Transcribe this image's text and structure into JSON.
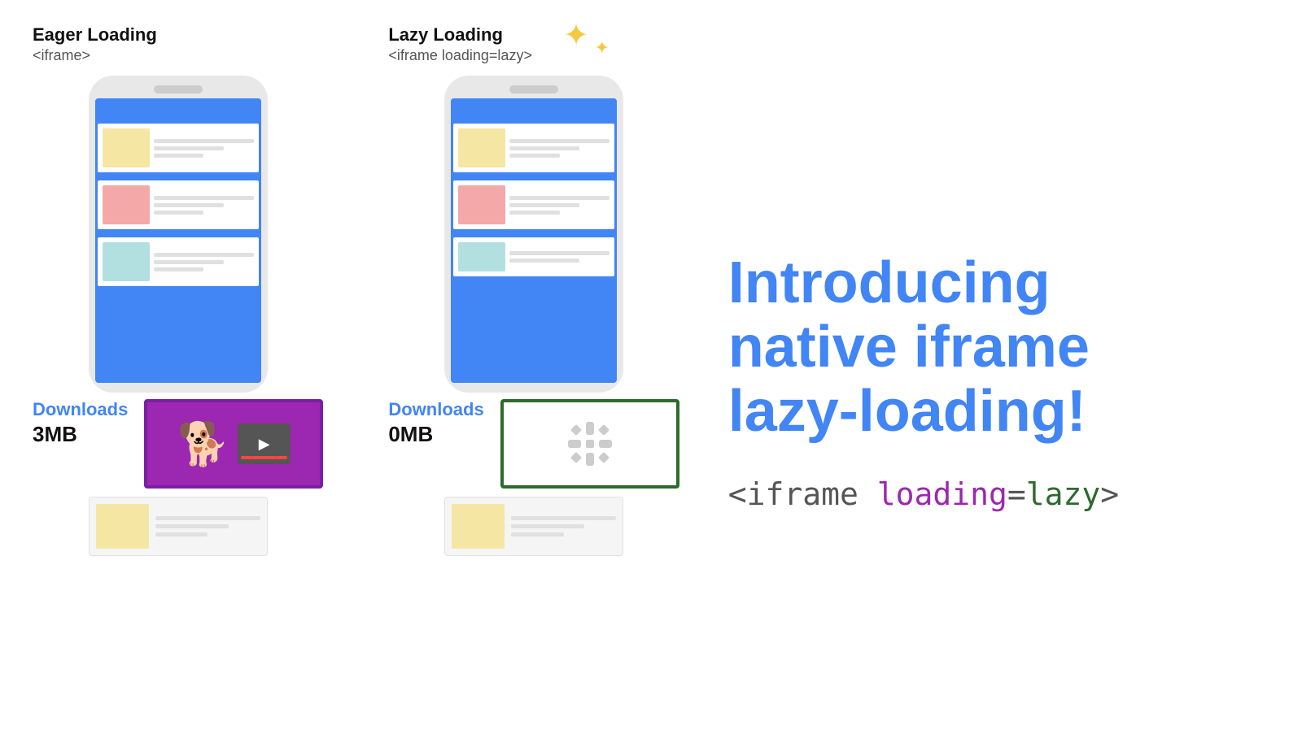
{
  "eager": {
    "title": "Eager Loading",
    "subtitle": "<iframe>",
    "downloads_label": "Downloads",
    "downloads_size": "3MB"
  },
  "lazy": {
    "title": "Lazy Loading",
    "subtitle": "<iframe loading=lazy>",
    "downloads_label": "Downloads",
    "downloads_size": "0MB"
  },
  "heading": {
    "line1": "Introducing",
    "line2": "native iframe",
    "line3": "lazy-loading!"
  },
  "code": {
    "prefix": "<iframe ",
    "loading": "loading",
    "equals": "=",
    "lazy": "lazy",
    "suffix": ">"
  },
  "colors": {
    "blue": "#4285f4",
    "purple": "#9c27b0",
    "green": "#2d6a2d",
    "gold": "#f5c842"
  }
}
